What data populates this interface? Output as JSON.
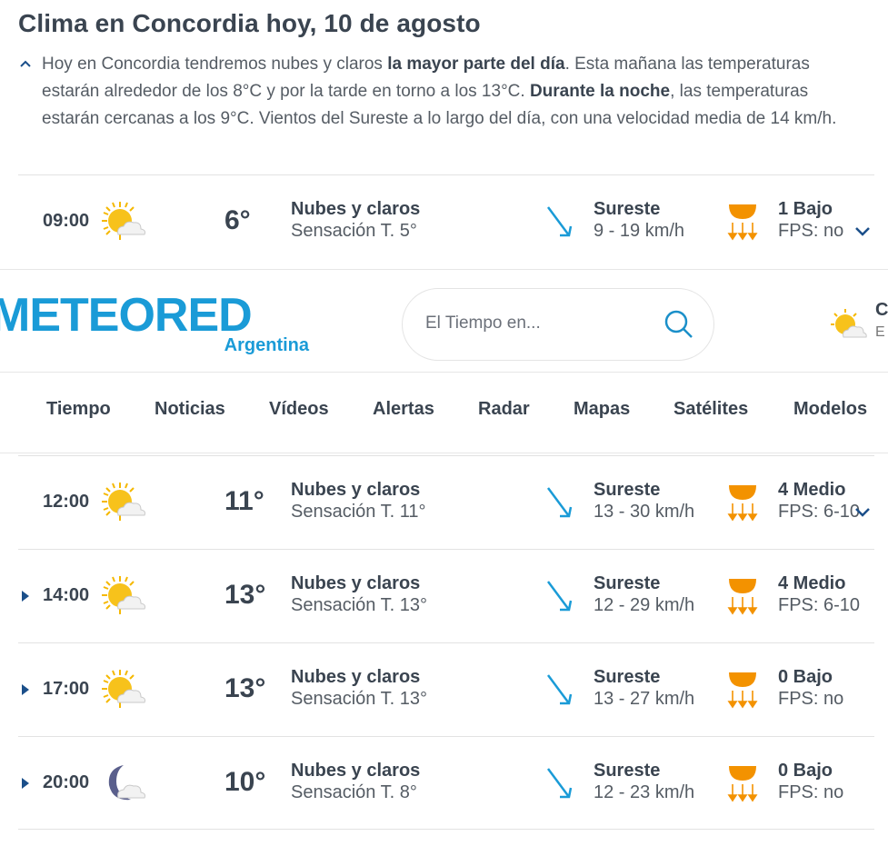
{
  "page": {
    "title": "Clima en Concordia hoy, 10 de agosto",
    "summary": {
      "part1": "Hoy en Concordia tendremos nubes y claros ",
      "bold1": "la mayor parte del día",
      "part2": ". Esta mañana las temperaturas estarán alrededor de los 8°C y por la tarde en torno a los 13°C. ",
      "bold2": "Durante la noche",
      "part3": ", las temperaturas estarán cercanas a los 9°C. Vientos del Sureste a lo largo del día, con una velocidad media de 14 km/h."
    }
  },
  "header": {
    "logo_text": "METEORED",
    "logo_sub": "Argentina",
    "search_placeholder": "El Tiempo en...",
    "weather_c": "C",
    "weather_e": "E",
    "nav": [
      "Tiempo",
      "Noticias",
      "Vídeos",
      "Alertas",
      "Radar",
      "Mapas",
      "Satélites",
      "Modelos"
    ]
  },
  "rows": [
    {
      "hour": "09:00",
      "icon": "sun-cloud-icon",
      "temp": "6°",
      "cond": "Nubes y claros",
      "feel": "Sensación T. 5°",
      "winddir": "Sureste",
      "windspd": "9 - 19 km/h",
      "uv": "1 Bajo",
      "fps": "FPS: no"
    },
    {
      "hour": "12:00",
      "icon": "sun-cloud-icon",
      "temp": "11°",
      "cond": "Nubes y claros",
      "feel": "Sensación T. 11°",
      "winddir": "Sureste",
      "windspd": "13 - 30 km/h",
      "uv": "4 Medio",
      "fps": "FPS: 6-10"
    },
    {
      "hour": "14:00",
      "icon": "sun-cloud-icon",
      "temp": "13°",
      "cond": "Nubes y claros",
      "feel": "Sensación T. 13°",
      "winddir": "Sureste",
      "windspd": "12 - 29 km/h",
      "uv": "4 Medio",
      "fps": "FPS: 6-10"
    },
    {
      "hour": "17:00",
      "icon": "sun-cloud-icon",
      "temp": "13°",
      "cond": "Nubes y claros",
      "feel": "Sensación T. 13°",
      "winddir": "Sureste",
      "windspd": "13 - 27 km/h",
      "uv": "0 Bajo",
      "fps": "FPS: no"
    },
    {
      "hour": "20:00",
      "icon": "moon-cloud-icon",
      "temp": "10°",
      "cond": "Nubes y claros",
      "feel": "Sensación T. 8°",
      "winddir": "Sureste",
      "windspd": "12 - 23 km/h",
      "uv": "0 Bajo",
      "fps": "FPS: no"
    }
  ],
  "colors": {
    "accent": "#1a9bd7",
    "text": "#3a4450",
    "uv": "#f39200"
  }
}
